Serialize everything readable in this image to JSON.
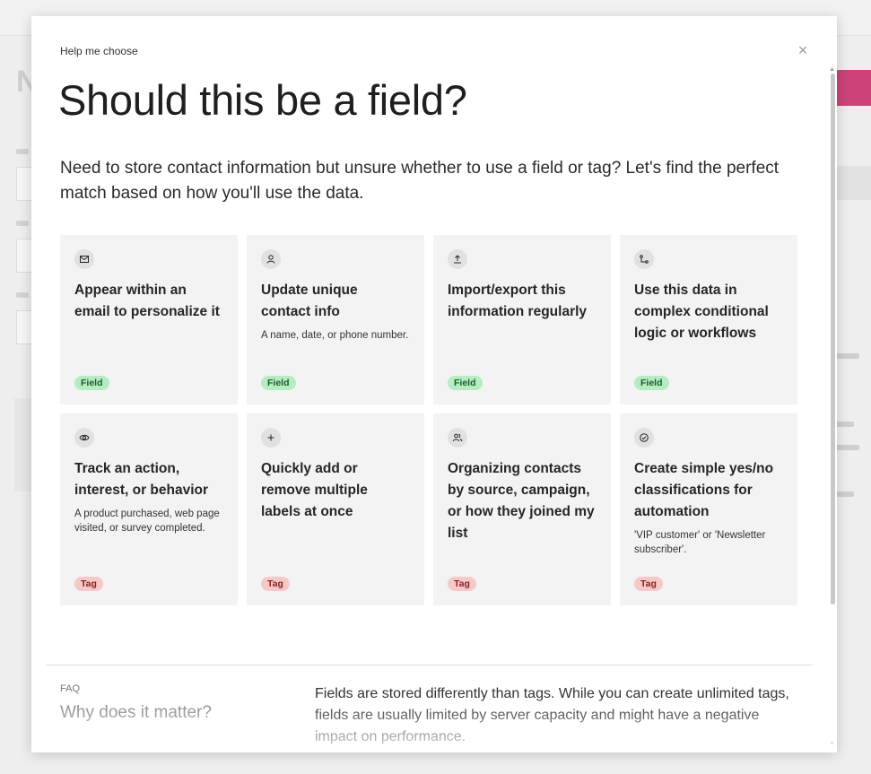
{
  "modal": {
    "eyebrow": "Help me choose",
    "title": "Should this be a field?",
    "intro": "Need to store contact information but unsure whether to use a field or tag? Let's find the perfect match based on how you'll use the data.",
    "close_label": "×",
    "cards": [
      {
        "icon": "envelope-icon",
        "title": "Appear within an email to personalize it",
        "desc": "",
        "badge": "Field",
        "badge_type": "field"
      },
      {
        "icon": "user-icon",
        "title": "Update unique contact info",
        "desc": "A name, date, or phone number.",
        "badge": "Field",
        "badge_type": "field"
      },
      {
        "icon": "upload-icon",
        "title": "Import/export this information regularly",
        "desc": "",
        "badge": "Field",
        "badge_type": "field"
      },
      {
        "icon": "workflow-icon",
        "title": "Use this data in complex conditional logic or workflows",
        "desc": "",
        "badge": "Field",
        "badge_type": "field"
      },
      {
        "icon": "eye-icon",
        "title": "Track an action, interest, or behavior",
        "desc": "A product purchased, web page visited, or survey completed.",
        "badge": "Tag",
        "badge_type": "tag"
      },
      {
        "icon": "plus-icon",
        "title": "Quickly add or remove multiple labels at once",
        "desc": "",
        "badge": "Tag",
        "badge_type": "tag"
      },
      {
        "icon": "users-icon",
        "title": "Organizing contacts by source, campaign, or how they joined my list",
        "desc": "",
        "badge": "Tag",
        "badge_type": "tag"
      },
      {
        "icon": "check-circle-icon",
        "title": "Create simple yes/no classifications for automation",
        "desc": "'VIP customer' or 'Newsletter subscriber'.",
        "badge": "Tag",
        "badge_type": "tag"
      }
    ],
    "faq": {
      "eyebrow": "FAQ",
      "title": "Why does it matter?",
      "text": "Fields are stored differently than tags. While you can create unlimited tags, fields are usually limited by server capacity and might have a negative impact on performance."
    }
  },
  "colors": {
    "field_badge_bg": "#b6ecc1",
    "tag_badge_bg": "#f6c9c9",
    "card_bg": "#f3f3f3",
    "brand_accent": "#c2185b"
  }
}
